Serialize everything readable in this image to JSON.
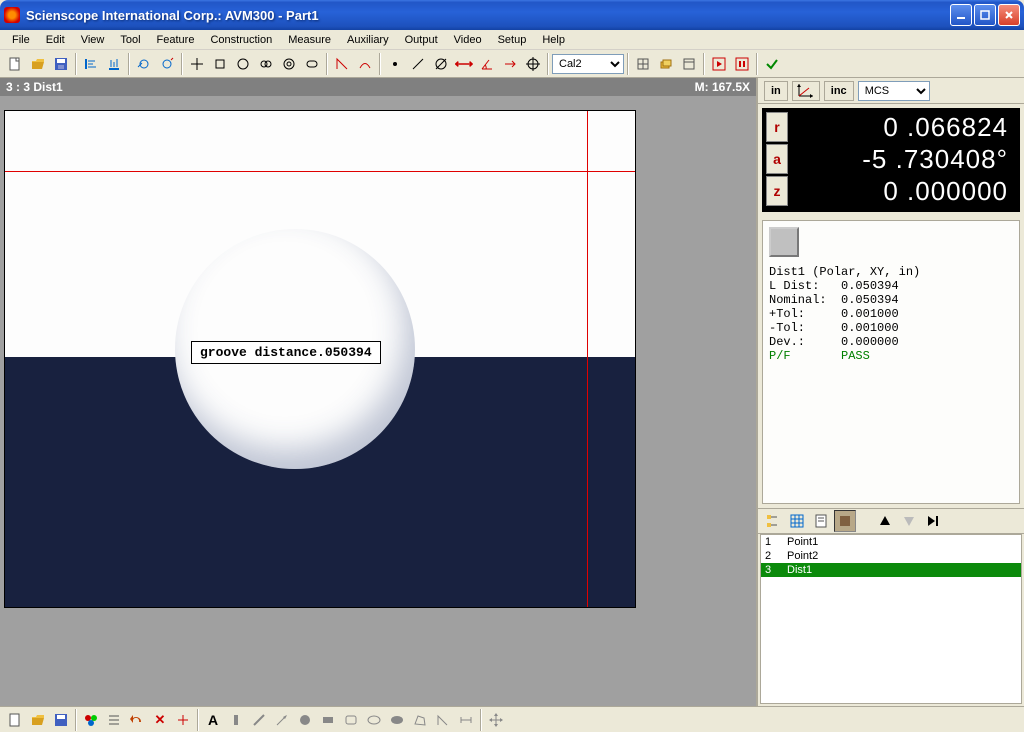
{
  "window": {
    "title": "Scienscope International Corp.: AVM300 - Part1"
  },
  "menu": [
    "File",
    "Edit",
    "View",
    "Tool",
    "Feature",
    "Construction",
    "Measure",
    "Auxiliary",
    "Output",
    "Video",
    "Setup",
    "Help"
  ],
  "toolbar": {
    "cal_dropdown": "Cal2"
  },
  "viewer": {
    "status_left": "3 : 3  Dist1",
    "status_right": "M: 167.5X",
    "annotation": "groove distance.050394"
  },
  "coordbar": {
    "unit": "in",
    "mode": "inc",
    "cs_dropdown": "MCS"
  },
  "dro": {
    "labels": [
      "r",
      "a",
      "z"
    ],
    "values": [
      "0 .066824",
      "-5 .730408°",
      "0 .000000"
    ]
  },
  "info": {
    "header": "Dist1 (Polar, XY, in)",
    "rows": [
      [
        "L Dist:",
        "0.050394"
      ],
      [
        "Nominal:",
        "0.050394"
      ],
      [
        "+Tol:",
        "0.001000"
      ],
      [
        "-Tol:",
        "0.001000"
      ],
      [
        "Dev.:",
        "0.000000"
      ]
    ],
    "pf_label": "P/F",
    "pf_value": "PASS"
  },
  "features": [
    {
      "n": "1",
      "name": "Point1",
      "sel": false
    },
    {
      "n": "2",
      "name": "Point2",
      "sel": false
    },
    {
      "n": "3",
      "name": "Dist1",
      "sel": true
    }
  ]
}
